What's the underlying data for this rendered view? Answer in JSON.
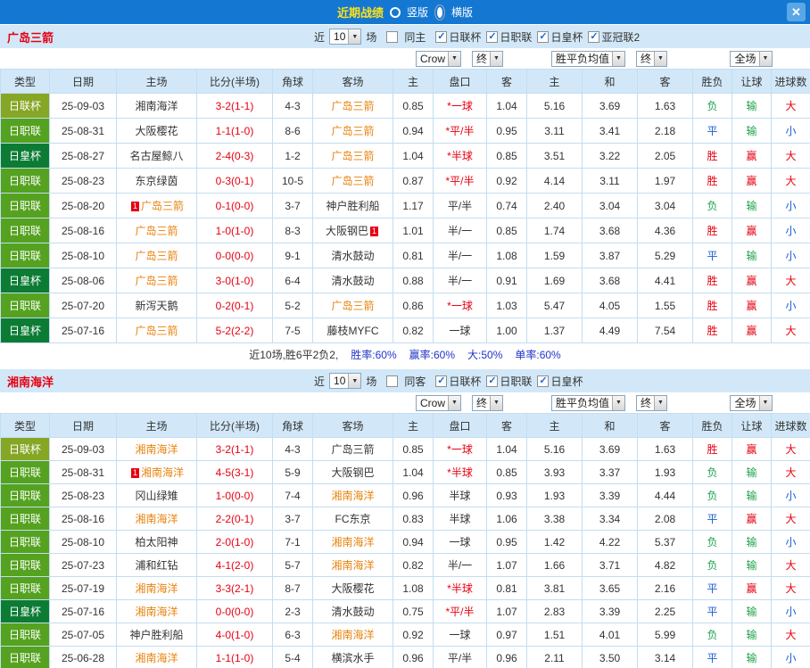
{
  "icons": {
    "check": "✓",
    "arrow": "▼",
    "close": "✕"
  },
  "titlebar": {
    "title": "近期战绩",
    "vertical": "竖版",
    "horizontal": "横版"
  },
  "filters": {
    "near": "近",
    "count": "10",
    "games": "场"
  },
  "table_header": {
    "cols": [
      "类型",
      "日期",
      "主场",
      "比分(半场)",
      "角球",
      "客场"
    ],
    "sub": [
      "主",
      "盘口",
      "客",
      "主",
      "和",
      "客",
      "胜负",
      "让球",
      "进球数"
    ],
    "selects": {
      "crow": "Crow",
      "end1": "终",
      "avg": "胜平负均值",
      "end2": "终",
      "full": "全场"
    }
  },
  "sections": [
    {
      "team": "广岛三箭",
      "same_label": "同主",
      "same_checked": false,
      "leagues": [
        {
          "label": "日联杯",
          "checked": true
        },
        {
          "label": "日职联",
          "checked": true
        },
        {
          "label": "日皇杯",
          "checked": true
        },
        {
          "label": "亚冠联2",
          "checked": true
        }
      ],
      "rows": [
        {
          "type": "日联杯",
          "tc": "#86a625",
          "date": "25-09-03",
          "home": "湘南海洋",
          "hh": false,
          "score": "3-2(1-1)",
          "corner": "4-3",
          "away": "广岛三箭",
          "ah": true,
          "h": "0.85",
          "hcp": "*一球",
          "hred": true,
          "a": "1.04",
          "m1": "5.16",
          "m2": "3.69",
          "m3": "1.63",
          "r1": "负",
          "c1": "l",
          "r2": "输",
          "c2": "l",
          "r3": "大",
          "c3": "w"
        },
        {
          "type": "日职联",
          "tc": "#54a21f",
          "date": "25-08-31",
          "home": "大阪樱花",
          "hh": false,
          "score": "1-1(1-0)",
          "corner": "8-6",
          "away": "广岛三箭",
          "ah": true,
          "h": "0.94",
          "hcp": "*平/半",
          "hred": true,
          "a": "0.95",
          "m1": "3.11",
          "m2": "3.41",
          "m3": "2.18",
          "r1": "平",
          "c1": "d",
          "r2": "输",
          "c2": "l",
          "r3": "小",
          "c3": "d"
        },
        {
          "type": "日皇杯",
          "tc": "#0c7c34",
          "date": "25-08-27",
          "home": "名古屋鲸八",
          "hh": false,
          "score": "2-4(0-3)",
          "corner": "1-2",
          "away": "广岛三箭",
          "ah": true,
          "h": "1.04",
          "hcp": "*半球",
          "hred": true,
          "a": "0.85",
          "m1": "3.51",
          "m2": "3.22",
          "m3": "2.05",
          "r1": "胜",
          "c1": "w",
          "r2": "赢",
          "c2": "w",
          "r3": "大",
          "c3": "w"
        },
        {
          "type": "日职联",
          "tc": "#54a21f",
          "date": "25-08-23",
          "home": "东京绿茵",
          "hh": false,
          "score": "0-3(0-1)",
          "corner": "10-5",
          "away": "广岛三箭",
          "ah": true,
          "h": "0.87",
          "hcp": "*平/半",
          "hred": true,
          "a": "0.92",
          "m1": "4.14",
          "m2": "3.11",
          "m3": "1.97",
          "r1": "胜",
          "c1": "w",
          "r2": "赢",
          "c2": "w",
          "r3": "大",
          "c3": "w"
        },
        {
          "type": "日职联",
          "tc": "#54a21f",
          "date": "25-08-20",
          "hb_pre": "1",
          "home": "广岛三箭",
          "hh": true,
          "score": "0-1(0-0)",
          "corner": "3-7",
          "away": "神户胜利船",
          "ah": false,
          "h": "1.17",
          "hcp": "平/半",
          "hred": false,
          "a": "0.74",
          "m1": "2.40",
          "m2": "3.04",
          "m3": "3.04",
          "r1": "负",
          "c1": "l",
          "r2": "输",
          "c2": "l",
          "r3": "小",
          "c3": "d"
        },
        {
          "type": "日职联",
          "tc": "#54a21f",
          "date": "25-08-16",
          "home": "广岛三箭",
          "hh": true,
          "score": "1-0(1-0)",
          "corner": "8-3",
          "away": "大阪钢巴",
          "ah": false,
          "ab_post": "1",
          "h": "1.01",
          "hcp": "半/一",
          "hred": false,
          "a": "0.85",
          "m1": "1.74",
          "m2": "3.68",
          "m3": "4.36",
          "r1": "胜",
          "c1": "w",
          "r2": "赢",
          "c2": "w",
          "r3": "小",
          "c3": "d"
        },
        {
          "type": "日职联",
          "tc": "#54a21f",
          "date": "25-08-10",
          "home": "广岛三箭",
          "hh": true,
          "score": "0-0(0-0)",
          "corner": "9-1",
          "away": "清水鼓动",
          "ah": false,
          "h": "0.81",
          "hcp": "半/一",
          "hred": false,
          "a": "1.08",
          "m1": "1.59",
          "m2": "3.87",
          "m3": "5.29",
          "r1": "平",
          "c1": "d",
          "r2": "输",
          "c2": "l",
          "r3": "小",
          "c3": "d"
        },
        {
          "type": "日皇杯",
          "tc": "#0c7c34",
          "date": "25-08-06",
          "home": "广岛三箭",
          "hh": true,
          "score": "3-0(1-0)",
          "corner": "6-4",
          "away": "清水鼓动",
          "ah": false,
          "h": "0.88",
          "hcp": "半/一",
          "hred": false,
          "a": "0.91",
          "m1": "1.69",
          "m2": "3.68",
          "m3": "4.41",
          "r1": "胜",
          "c1": "w",
          "r2": "赢",
          "c2": "w",
          "r3": "大",
          "c3": "w"
        },
        {
          "type": "日职联",
          "tc": "#54a21f",
          "date": "25-07-20",
          "home": "新泻天鹅",
          "hh": false,
          "score": "0-2(0-1)",
          "corner": "5-2",
          "away": "广岛三箭",
          "ah": true,
          "h": "0.86",
          "hcp": "*一球",
          "hred": true,
          "a": "1.03",
          "m1": "5.47",
          "m2": "4.05",
          "m3": "1.55",
          "r1": "胜",
          "c1": "w",
          "r2": "赢",
          "c2": "w",
          "r3": "小",
          "c3": "d"
        },
        {
          "type": "日皇杯",
          "tc": "#0c7c34",
          "date": "25-07-16",
          "home": "广岛三箭",
          "hh": true,
          "score": "5-2(2-2)",
          "corner": "7-5",
          "away": "藤枝MYFC",
          "ah": false,
          "h": "0.82",
          "hcp": "一球",
          "hred": false,
          "a": "1.00",
          "m1": "1.37",
          "m2": "4.49",
          "m3": "7.54",
          "r1": "胜",
          "c1": "w",
          "r2": "赢",
          "c2": "w",
          "r3": "大",
          "c3": "w"
        }
      ],
      "summary": {
        "lead": "近10场,胜6平2负2,",
        "stats": [
          "胜率:60%",
          "赢率:60%",
          "大:50%",
          "单率:60%"
        ]
      }
    },
    {
      "team": "湘南海洋",
      "same_label": "同客",
      "same_checked": false,
      "leagues": [
        {
          "label": "日联杯",
          "checked": true
        },
        {
          "label": "日职联",
          "checked": true
        },
        {
          "label": "日皇杯",
          "checked": true
        }
      ],
      "rows": [
        {
          "type": "日联杯",
          "tc": "#86a625",
          "date": "25-09-03",
          "home": "湘南海洋",
          "hh": true,
          "score": "3-2(1-1)",
          "corner": "4-3",
          "away": "广岛三箭",
          "ah": false,
          "h": "0.85",
          "hcp": "*一球",
          "hred": true,
          "a": "1.04",
          "m1": "5.16",
          "m2": "3.69",
          "m3": "1.63",
          "r1": "胜",
          "c1": "w",
          "r2": "赢",
          "c2": "w",
          "r3": "大",
          "c3": "w"
        },
        {
          "type": "日职联",
          "tc": "#54a21f",
          "date": "25-08-31",
          "hb_pre": "1",
          "home": "湘南海洋",
          "hh": true,
          "score": "4-5(3-1)",
          "corner": "5-9",
          "away": "大阪钢巴",
          "ah": false,
          "h": "1.04",
          "hcp": "*半球",
          "hred": true,
          "a": "0.85",
          "m1": "3.93",
          "m2": "3.37",
          "m3": "1.93",
          "r1": "负",
          "c1": "l",
          "r2": "输",
          "c2": "l",
          "r3": "大",
          "c3": "w"
        },
        {
          "type": "日职联",
          "tc": "#54a21f",
          "date": "25-08-23",
          "home": "冈山绿雉",
          "hh": false,
          "score": "1-0(0-0)",
          "corner": "7-4",
          "away": "湘南海洋",
          "ah": true,
          "h": "0.96",
          "hcp": "半球",
          "hred": false,
          "a": "0.93",
          "m1": "1.93",
          "m2": "3.39",
          "m3": "4.44",
          "r1": "负",
          "c1": "l",
          "r2": "输",
          "c2": "l",
          "r3": "小",
          "c3": "d"
        },
        {
          "type": "日职联",
          "tc": "#54a21f",
          "date": "25-08-16",
          "home": "湘南海洋",
          "hh": true,
          "score": "2-2(0-1)",
          "corner": "3-7",
          "away": "FC东京",
          "ah": false,
          "h": "0.83",
          "hcp": "半球",
          "hred": false,
          "a": "1.06",
          "m1": "3.38",
          "m2": "3.34",
          "m3": "2.08",
          "r1": "平",
          "c1": "d",
          "r2": "赢",
          "c2": "w",
          "r3": "大",
          "c3": "w"
        },
        {
          "type": "日职联",
          "tc": "#54a21f",
          "date": "25-08-10",
          "home": "柏太阳神",
          "hh": false,
          "score": "2-0(1-0)",
          "corner": "7-1",
          "away": "湘南海洋",
          "ah": true,
          "h": "0.94",
          "hcp": "一球",
          "hred": false,
          "a": "0.95",
          "m1": "1.42",
          "m2": "4.22",
          "m3": "5.37",
          "r1": "负",
          "c1": "l",
          "r2": "输",
          "c2": "l",
          "r3": "小",
          "c3": "d"
        },
        {
          "type": "日职联",
          "tc": "#54a21f",
          "date": "25-07-23",
          "home": "浦和红钻",
          "hh": false,
          "score": "4-1(2-0)",
          "corner": "5-7",
          "away": "湘南海洋",
          "ah": true,
          "h": "0.82",
          "hcp": "半/一",
          "hred": false,
          "a": "1.07",
          "m1": "1.66",
          "m2": "3.71",
          "m3": "4.82",
          "r1": "负",
          "c1": "l",
          "r2": "输",
          "c2": "l",
          "r3": "大",
          "c3": "w"
        },
        {
          "type": "日职联",
          "tc": "#54a21f",
          "date": "25-07-19",
          "home": "湘南海洋",
          "hh": true,
          "score": "3-3(2-1)",
          "corner": "8-7",
          "away": "大阪樱花",
          "ah": false,
          "h": "1.08",
          "hcp": "*半球",
          "hred": true,
          "a": "0.81",
          "m1": "3.81",
          "m2": "3.65",
          "m3": "2.16",
          "r1": "平",
          "c1": "d",
          "r2": "赢",
          "c2": "w",
          "r3": "大",
          "c3": "w"
        },
        {
          "type": "日皇杯",
          "tc": "#0c7c34",
          "date": "25-07-16",
          "home": "湘南海洋",
          "hh": true,
          "score": "0-0(0-0)",
          "corner": "2-3",
          "away": "清水鼓动",
          "ah": false,
          "h": "0.75",
          "hcp": "*平/半",
          "hred": true,
          "a": "1.07",
          "m1": "2.83",
          "m2": "3.39",
          "m3": "2.25",
          "r1": "平",
          "c1": "d",
          "r2": "输",
          "c2": "l",
          "r3": "小",
          "c3": "d"
        },
        {
          "type": "日职联",
          "tc": "#54a21f",
          "date": "25-07-05",
          "home": "神户胜利船",
          "hh": false,
          "score": "4-0(1-0)",
          "corner": "6-3",
          "away": "湘南海洋",
          "ah": true,
          "h": "0.92",
          "hcp": "一球",
          "hred": false,
          "a": "0.97",
          "m1": "1.51",
          "m2": "4.01",
          "m3": "5.99",
          "r1": "负",
          "c1": "l",
          "r2": "输",
          "c2": "l",
          "r3": "大",
          "c3": "w"
        },
        {
          "type": "日职联",
          "tc": "#54a21f",
          "date": "25-06-28",
          "home": "湘南海洋",
          "hh": true,
          "score": "1-1(1-0)",
          "corner": "5-4",
          "away": "横滨水手",
          "ah": false,
          "h": "0.96",
          "hcp": "平/半",
          "hred": false,
          "a": "0.96",
          "m1": "2.11",
          "m2": "3.50",
          "m3": "3.14",
          "r1": "平",
          "c1": "d",
          "r2": "输",
          "c2": "l",
          "r3": "小",
          "c3": "d"
        }
      ]
    }
  ]
}
